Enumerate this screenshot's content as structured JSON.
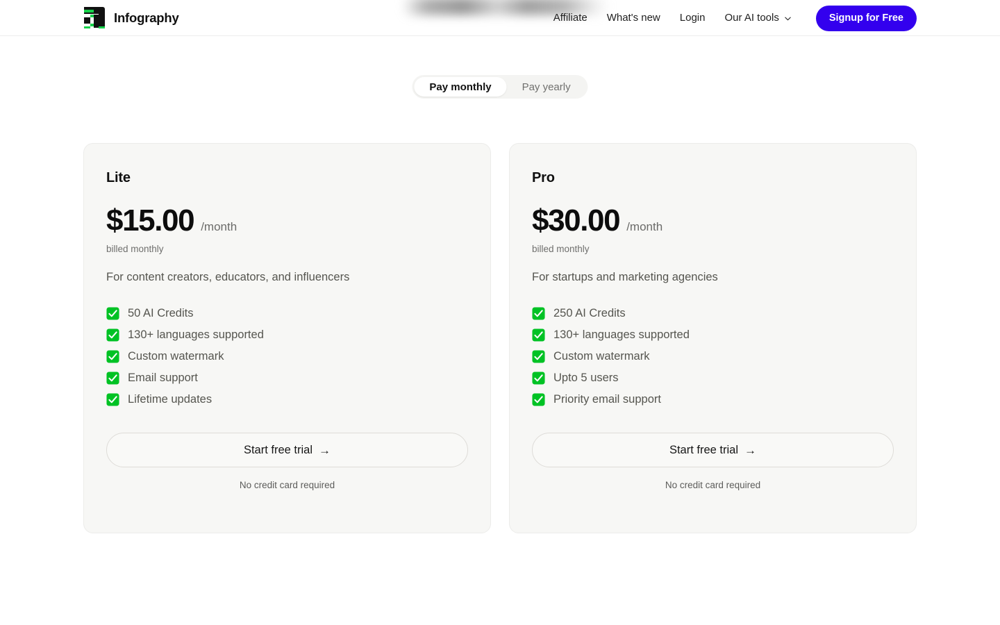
{
  "header": {
    "brand_name": "Infography",
    "logo_icon": "infography-logo-icon",
    "nav_links": [
      {
        "label": "Affiliate",
        "icon": null
      },
      {
        "label": "What's new",
        "icon": null
      },
      {
        "label": "Login",
        "icon": null
      },
      {
        "label": "Our AI tools",
        "icon": "chevron-down-icon"
      }
    ],
    "signup_label": "Signup for Free",
    "signup_color": "#3300ee",
    "obscured_region_label": "blurred-nav-content"
  },
  "billing_toggle": {
    "options": [
      {
        "label": "Pay monthly",
        "active": true
      },
      {
        "label": "Pay yearly",
        "active": false
      }
    ]
  },
  "plans": [
    {
      "name": "Lite",
      "price": "$15.00",
      "period": "/month",
      "billed_note": "billed monthly",
      "description": "For content creators, educators, and influencers",
      "features": [
        "50 AI Credits",
        "130+ languages supported",
        "Custom watermark",
        "Email support",
        "Lifetime updates"
      ],
      "cta_label": "Start free trial",
      "cta_arrow": "→",
      "cta_note": "No credit card required"
    },
    {
      "name": "Pro",
      "price": "$30.00",
      "period": "/month",
      "billed_note": "billed monthly",
      "description": "For startups and marketing agencies",
      "features": [
        "250 AI Credits",
        "130+ languages supported",
        "Custom watermark",
        "Upto 5 users",
        "Priority email support"
      ],
      "cta_label": "Start free trial",
      "cta_arrow": "→",
      "cta_note": "No credit card required"
    }
  ],
  "colors": {
    "page_background": "#ffffff",
    "card_background": "#f7f7f5",
    "card_border": "#ececea",
    "accent": "#3300ee",
    "check_green": "#00c224",
    "text_primary": "#101010",
    "text_muted": "#55554f"
  }
}
